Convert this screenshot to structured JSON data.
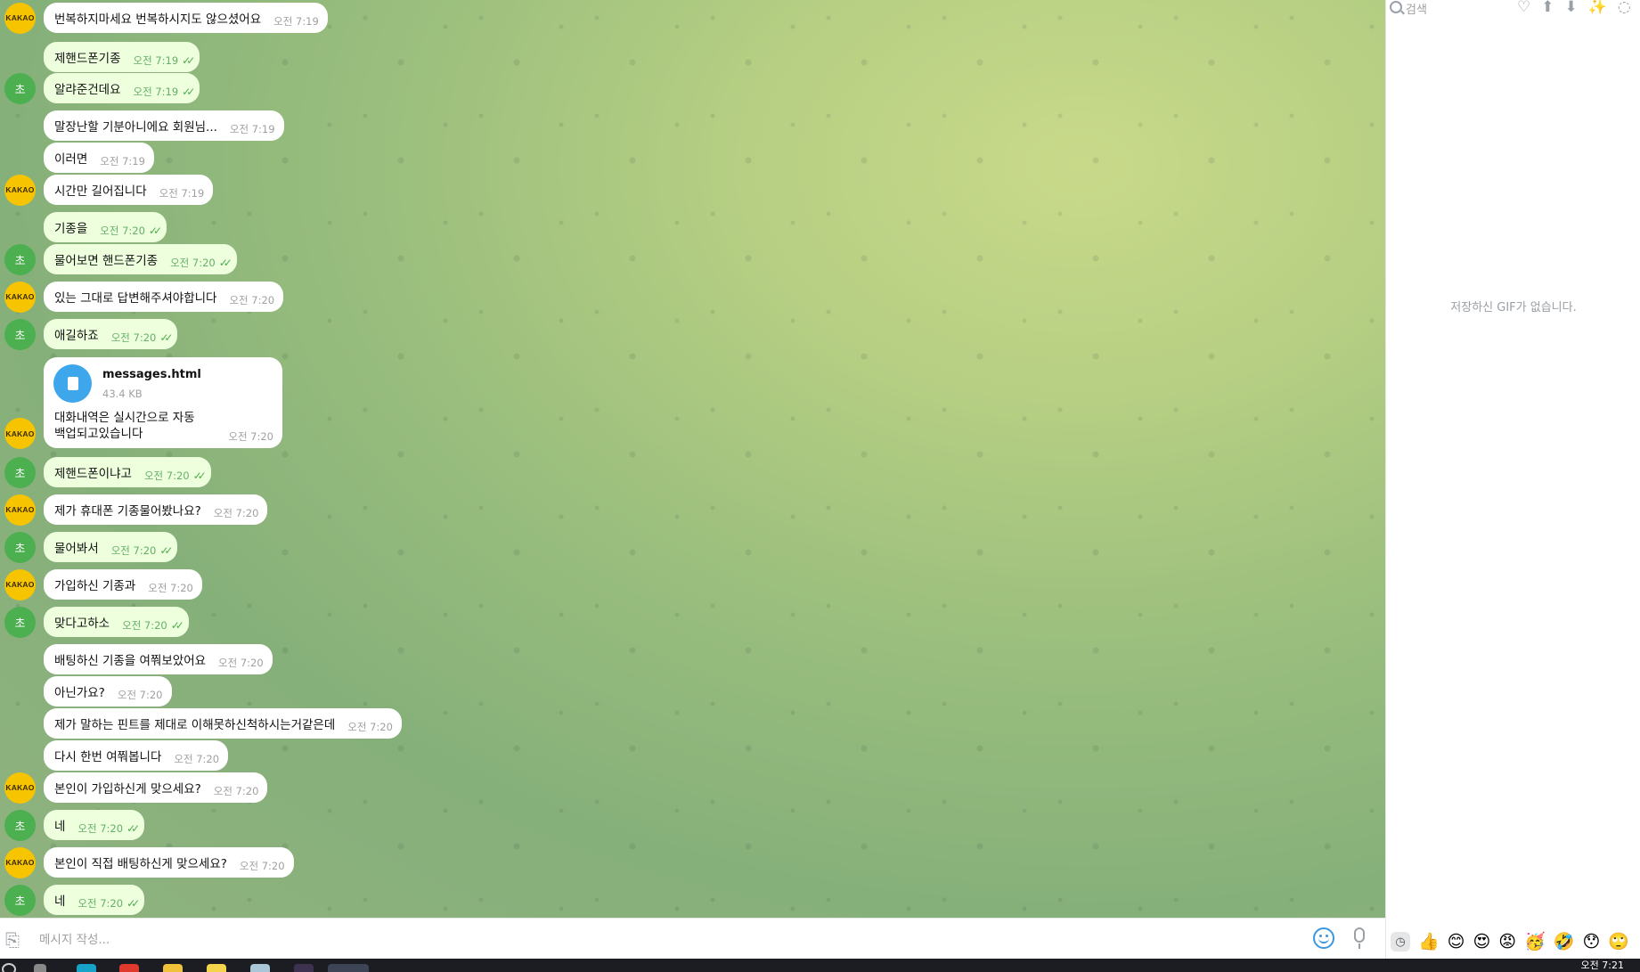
{
  "chat": {
    "avatar_kakao_label": "KAKAO",
    "avatar_user_label": "초",
    "messages": [
      {
        "dir": "in",
        "text": "번복하지마세요 번복하시지도 않으셨어요",
        "time": "오전 7:19"
      },
      {
        "dir": "out",
        "text": "제핸드폰기종",
        "time": "오전 7:19"
      },
      {
        "dir": "out",
        "text": "알랴준건데요",
        "time": "오전 7:19"
      },
      {
        "dir": "in",
        "text": "말장난할 기분아니에요 회원님...",
        "time": "오전 7:19"
      },
      {
        "dir": "in",
        "text": "이러면",
        "time": "오전 7:19"
      },
      {
        "dir": "in",
        "text": "시간만 길어집니다",
        "time": "오전 7:19"
      },
      {
        "dir": "out",
        "text": "기종을",
        "time": "오전 7:20"
      },
      {
        "dir": "out",
        "text": "물어보면 핸드폰기종",
        "time": "오전 7:20"
      },
      {
        "dir": "in",
        "text": "있는 그대로 답변해주셔야합니다",
        "time": "오전 7:20"
      },
      {
        "dir": "out",
        "text": "애길하죠",
        "time": "오전 7:20"
      },
      {
        "dir": "in",
        "text": "",
        "time": ""
      },
      {
        "dir": "out",
        "text": "제핸드폰이냐고",
        "time": "오전 7:20"
      },
      {
        "dir": "in",
        "text": "제가 휴대폰 기종물어봤나요?",
        "time": "오전 7:20"
      },
      {
        "dir": "out",
        "text": "물어봐서",
        "time": "오전 7:20"
      },
      {
        "dir": "in",
        "text": "가입하신 기종과",
        "time": "오전 7:20"
      },
      {
        "dir": "out",
        "text": "맞다고하소",
        "time": "오전 7:20"
      },
      {
        "dir": "in",
        "text": "배팅하신 기종을 여쭤보았어요",
        "time": "오전 7:20"
      },
      {
        "dir": "in",
        "text": "아닌가요?",
        "time": "오전 7:20"
      },
      {
        "dir": "in",
        "text": "제가 말하는 핀트를 제대로 이해못하신척하시는거같은데",
        "time": "오전 7:20"
      },
      {
        "dir": "in",
        "text": "다시 한번 여쭤봅니다",
        "time": "오전 7:20"
      },
      {
        "dir": "in",
        "text": "본인이 가입하신게 맞으세요?",
        "time": "오전 7:20"
      },
      {
        "dir": "out",
        "text": "네",
        "time": "오전 7:20"
      },
      {
        "dir": "in",
        "text": "본인이 직접 배팅하신게 맞으세요?",
        "time": "오전 7:20"
      },
      {
        "dir": "out",
        "text": "네",
        "time": "오전 7:20"
      }
    ],
    "file_message": {
      "name": "messages.html",
      "size": "43.4 KB",
      "caption_line1": "대화내역은 실시간으로 자동",
      "caption_line2": "백업되고있습니다",
      "time": "오전 7:20"
    }
  },
  "input": {
    "placeholder": "메시지 작성..."
  },
  "panel": {
    "search_placeholder": "검색",
    "empty_text": "저장하신 GIF가 없습니다.",
    "tool_icons": [
      "heart-icon",
      "thumbs-up-icon",
      "thumbs-down-icon",
      "party-icon",
      "more-icon"
    ],
    "emojis": [
      "👍",
      "😊",
      "😍",
      "😡",
      "🥳",
      "🤣",
      "😯",
      "🙄"
    ]
  },
  "taskbar": {
    "clock": "오전 7:21"
  }
}
